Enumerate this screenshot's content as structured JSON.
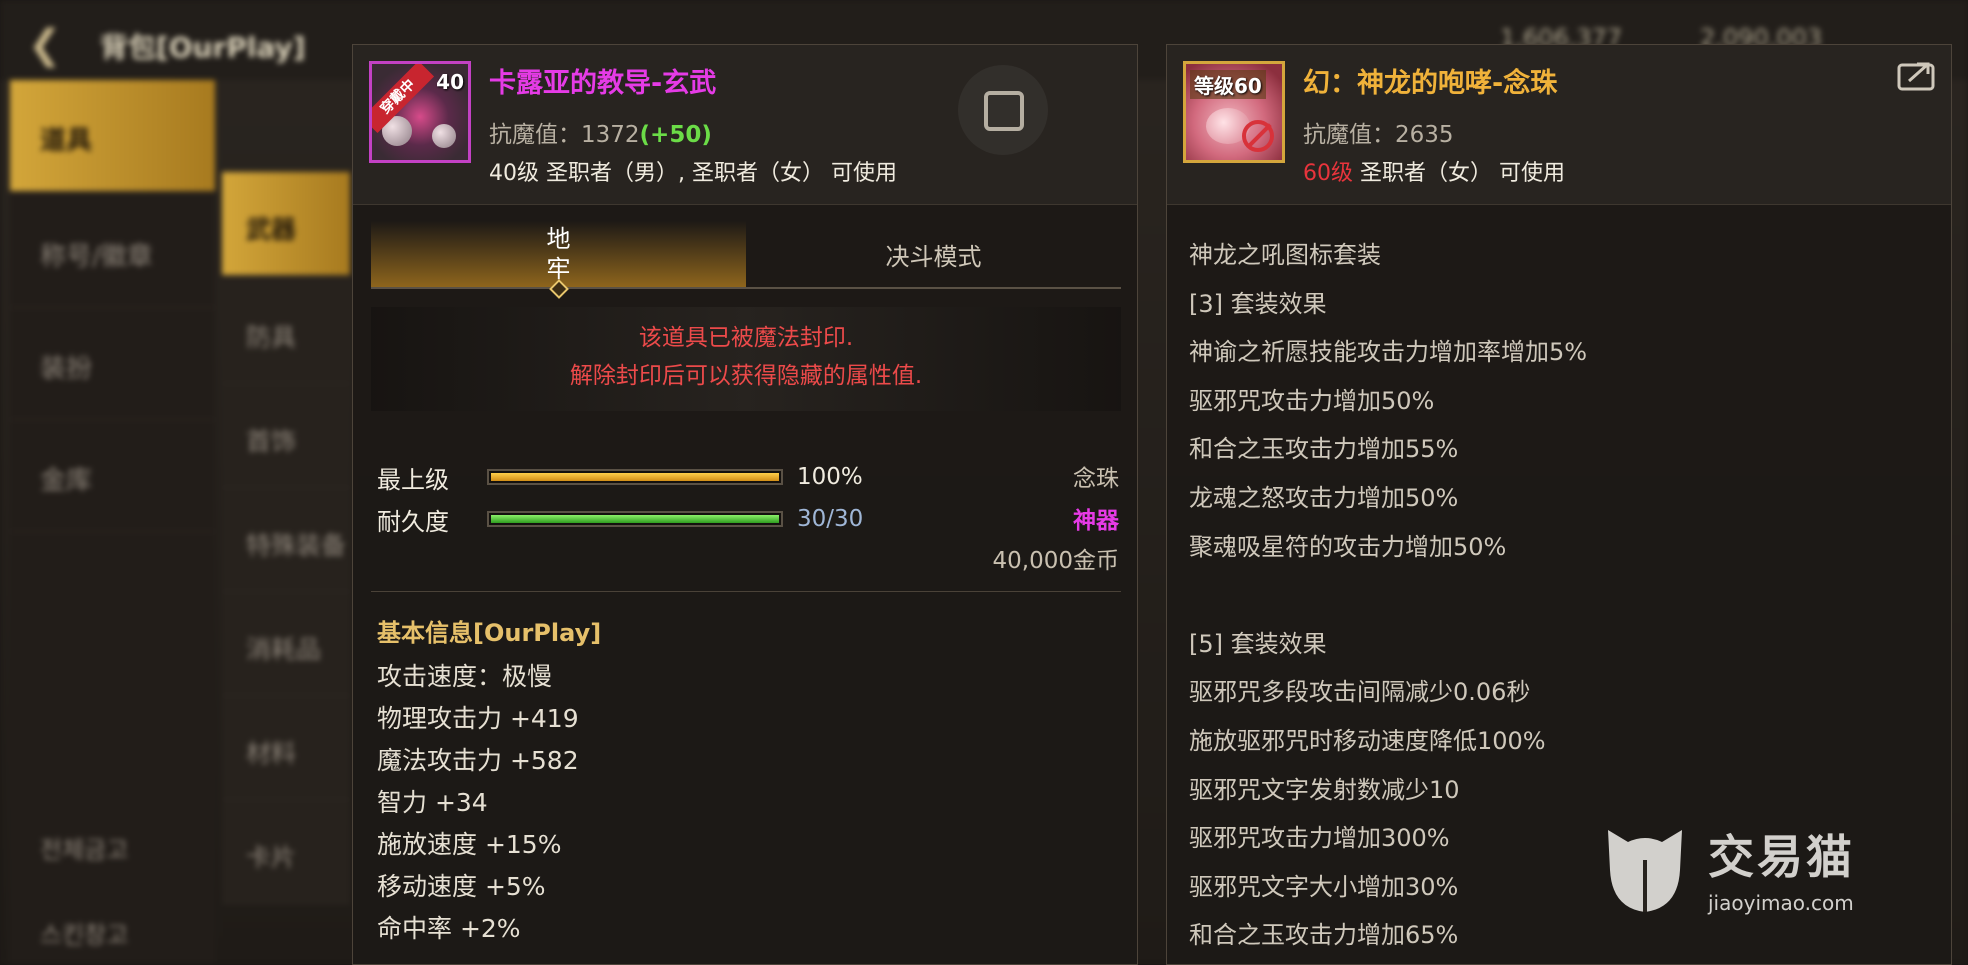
{
  "background": {
    "title": "背包[OurPlay]",
    "currency": [
      "1,606,377",
      "2,090,003"
    ],
    "sidebar": [
      "道具",
      "称号/徽章",
      "装扮",
      "金库"
    ],
    "subcategories": [
      "武器",
      "防具",
      "首饰",
      "特殊装备",
      "消耗品",
      "材料",
      "卡片"
    ],
    "bottom_items": [
      "전체금고",
      "스킨창고"
    ]
  },
  "left_item": {
    "icon": {
      "level_badge": "40",
      "ribbon": "穿戴中"
    },
    "name": "卡露亚的教导-玄武",
    "name_color": "#e53be6",
    "resist_label": "抗魔值：",
    "resist_value": "1372",
    "resist_bonus": "(+50)",
    "requirement": "40级 圣职者（男）, 圣职者（女） 可使用",
    "tabs": {
      "active_line1": "地",
      "active_line2": "牢",
      "inactive": "决斗模式"
    },
    "seal_line1": "该道具已被魔法封印.",
    "seal_line2": "解除封印后可以获得隐藏的属性值.",
    "grade_label": "最上级",
    "grade_value": "100%",
    "grade_fraction": 1.0,
    "durability_label": "耐久度",
    "durability_value": "30/30",
    "durability_fraction": 1.0,
    "item_type": "念珠",
    "rarity": "神器",
    "rarity_color": "#e63ae6",
    "price": "40,000金币",
    "basic_title": "基本信息[OurPlay]",
    "stats": [
      "攻击速度：极慢",
      "物理攻击力 +419",
      "魔法攻击力 +582",
      "智力 +34",
      "施放速度 +15%",
      "移动速度 +5%",
      "命中率 +2%"
    ]
  },
  "right_item": {
    "icon": {
      "level_badge": "等级60"
    },
    "name": "幻：神龙的咆哮-念珠",
    "name_color": "#f0b23a",
    "resist_label": "抗魔值：",
    "resist_value": "2635",
    "requirement_level": "60级",
    "requirement_rest": " 圣职者（女） 可使用",
    "set_lines": [
      "神龙之吼图标套装",
      "[3] 套装效果",
      "神谕之祈愿技能攻击力增加率增加5%",
      "驱邪咒攻击力增加50%",
      "和合之玉攻击力增加55%",
      "龙魂之怒攻击力增加50%",
      "聚魂吸星符的攻击力增加50%",
      "",
      "[5] 套装效果",
      "驱邪咒多段攻击间隔减少0.06秒",
      "施放驱邪咒时移动速度降低100%",
      "驱邪咒文字发射数减少10",
      "驱邪咒攻击力增加300%",
      "驱邪咒文字大小增加30%",
      "和合之玉攻击力增加65%"
    ]
  },
  "watermark": {
    "cn": "交易猫",
    "en": "jiaoyimao.com"
  }
}
